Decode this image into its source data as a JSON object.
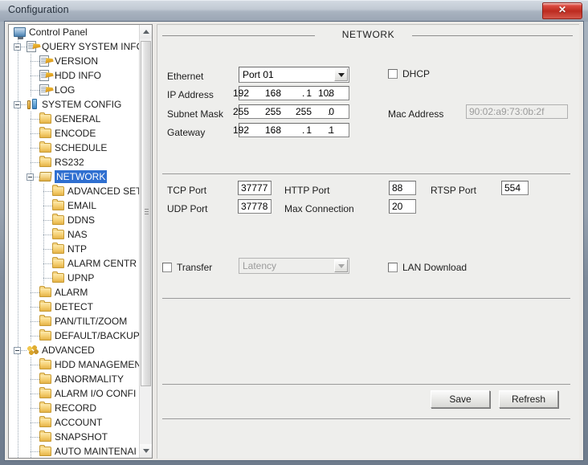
{
  "window": {
    "title": "Configuration",
    "close_label": "✕"
  },
  "tree": {
    "items": [
      {
        "label": "Control Panel",
        "icon": "monitor-icon",
        "depth": 0,
        "expander": "none",
        "selected": false
      },
      {
        "label": "QUERY SYSTEM INFO",
        "icon": "document-icon",
        "depth": 1,
        "expander": "expanded",
        "selected": false
      },
      {
        "label": "VERSION",
        "icon": "document-icon",
        "depth": 2,
        "expander": "none",
        "selected": false
      },
      {
        "label": "HDD INFO",
        "icon": "document-icon",
        "depth": 2,
        "expander": "none",
        "selected": false
      },
      {
        "label": "LOG",
        "icon": "document-icon",
        "depth": 2,
        "expander": "none",
        "selected": false
      },
      {
        "label": "SYSTEM CONFIG",
        "icon": "tools-icon",
        "depth": 1,
        "expander": "expanded",
        "selected": false
      },
      {
        "label": "GENERAL",
        "icon": "folder-icon",
        "depth": 2,
        "expander": "none",
        "selected": false
      },
      {
        "label": "ENCODE",
        "icon": "folder-icon",
        "depth": 2,
        "expander": "none",
        "selected": false
      },
      {
        "label": "SCHEDULE",
        "icon": "folder-icon",
        "depth": 2,
        "expander": "none",
        "selected": false
      },
      {
        "label": "RS232",
        "icon": "folder-icon",
        "depth": 2,
        "expander": "none",
        "selected": false
      },
      {
        "label": "NETWORK",
        "icon": "folder-open-icon",
        "depth": 2,
        "expander": "expanded",
        "selected": true
      },
      {
        "label": "ADVANCED SET",
        "icon": "folder-icon",
        "depth": 3,
        "expander": "none",
        "selected": false
      },
      {
        "label": "EMAIL",
        "icon": "folder-icon",
        "depth": 3,
        "expander": "none",
        "selected": false
      },
      {
        "label": "DDNS",
        "icon": "folder-icon",
        "depth": 3,
        "expander": "none",
        "selected": false
      },
      {
        "label": "NAS",
        "icon": "folder-icon",
        "depth": 3,
        "expander": "none",
        "selected": false
      },
      {
        "label": "NTP",
        "icon": "folder-icon",
        "depth": 3,
        "expander": "none",
        "selected": false
      },
      {
        "label": "ALARM CENTR",
        "icon": "folder-icon",
        "depth": 3,
        "expander": "none",
        "selected": false
      },
      {
        "label": "UPNP",
        "icon": "folder-icon",
        "depth": 3,
        "expander": "none",
        "selected": false
      },
      {
        "label": "ALARM",
        "icon": "folder-icon",
        "depth": 2,
        "expander": "none",
        "selected": false
      },
      {
        "label": "DETECT",
        "icon": "folder-icon",
        "depth": 2,
        "expander": "none",
        "selected": false
      },
      {
        "label": "PAN/TILT/ZOOM",
        "icon": "folder-icon",
        "depth": 2,
        "expander": "none",
        "selected": false
      },
      {
        "label": "DEFAULT/BACKUP",
        "icon": "folder-icon",
        "depth": 2,
        "expander": "none",
        "selected": false
      },
      {
        "label": "ADVANCED",
        "icon": "advanced-icon",
        "depth": 1,
        "expander": "expanded",
        "selected": false
      },
      {
        "label": "HDD MANAGEMEN",
        "icon": "folder-icon",
        "depth": 2,
        "expander": "none",
        "selected": false
      },
      {
        "label": "ABNORMALITY",
        "icon": "folder-icon",
        "depth": 2,
        "expander": "none",
        "selected": false
      },
      {
        "label": "ALARM I/O CONFI",
        "icon": "folder-icon",
        "depth": 2,
        "expander": "none",
        "selected": false
      },
      {
        "label": "RECORD",
        "icon": "folder-icon",
        "depth": 2,
        "expander": "none",
        "selected": false
      },
      {
        "label": "ACCOUNT",
        "icon": "folder-icon",
        "depth": 2,
        "expander": "none",
        "selected": false
      },
      {
        "label": "SNAPSHOT",
        "icon": "folder-icon",
        "depth": 2,
        "expander": "none",
        "selected": false
      },
      {
        "label": "AUTO MAINTENAI",
        "icon": "folder-icon",
        "depth": 2,
        "expander": "none",
        "selected": false
      }
    ],
    "scrollbar": {
      "up_arrow": "▲",
      "down_arrow": "▼"
    }
  },
  "panel": {
    "title": "NETWORK",
    "ethernet": {
      "label": "Ethernet",
      "value": "Port 01"
    },
    "ip_address": {
      "label": "IP Address",
      "octets": [
        "192",
        "168",
        "1",
        "108"
      ]
    },
    "subnet_mask": {
      "label": "Subnet Mask",
      "octets": [
        "255",
        "255",
        "255",
        "0"
      ]
    },
    "gateway": {
      "label": "Gateway",
      "octets": [
        "192",
        "168",
        "1",
        "1"
      ]
    },
    "dhcp": {
      "label": "DHCP",
      "checked": false
    },
    "mac_address": {
      "label": "Mac Address",
      "value": "90:02:a9:73:0b:2f",
      "disabled": true
    },
    "tcp_port": {
      "label": "TCP Port",
      "value": "37777"
    },
    "udp_port": {
      "label": "UDP Port",
      "value": "37778"
    },
    "http_port": {
      "label": "HTTP Port",
      "value": "88"
    },
    "max_connection": {
      "label": "Max Connection",
      "value": "20"
    },
    "rtsp_port": {
      "label": "RTSP Port",
      "value": "554"
    },
    "transfer": {
      "label": "Transfer",
      "checked": false
    },
    "latency": {
      "value": "Latency",
      "disabled": true
    },
    "lan_download": {
      "label": "LAN Download",
      "checked": false
    },
    "save_button": "Save",
    "refresh_button": "Refresh"
  }
}
